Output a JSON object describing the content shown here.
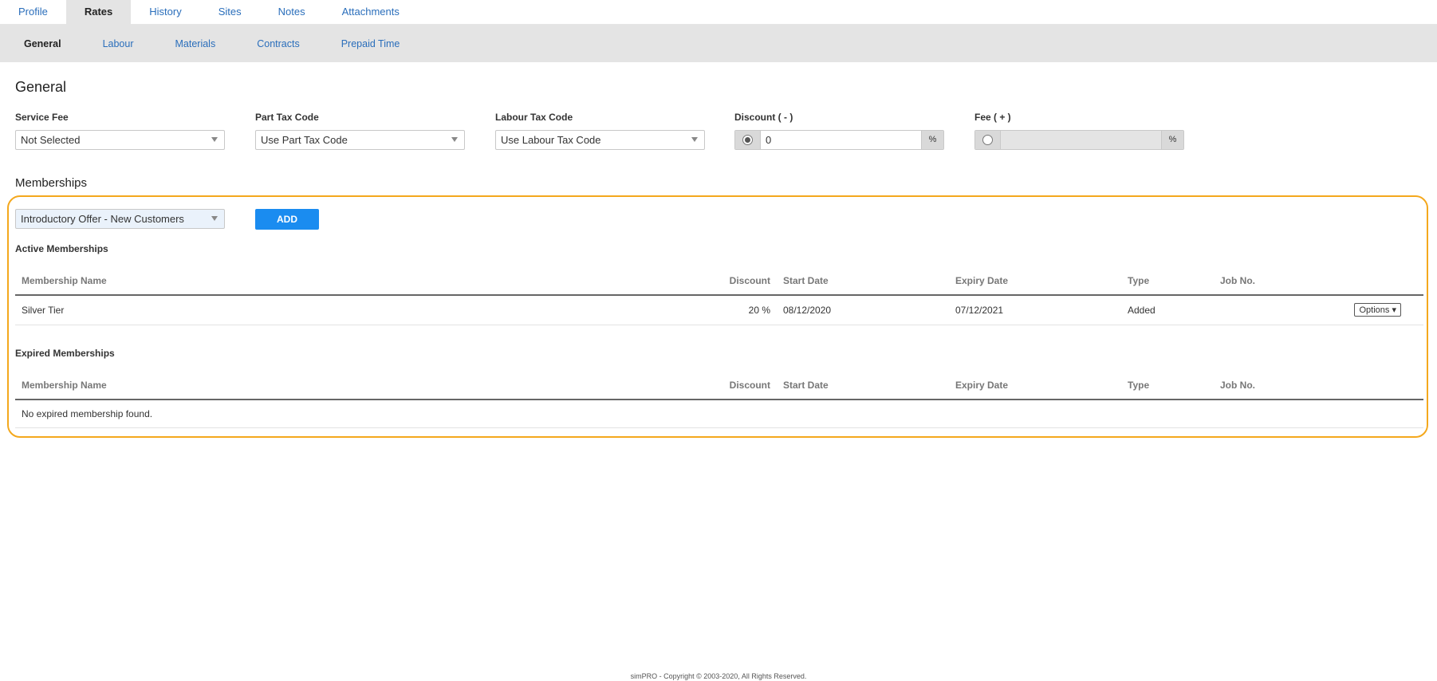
{
  "top_tabs": [
    {
      "label": "Profile"
    },
    {
      "label": "Rates"
    },
    {
      "label": "History"
    },
    {
      "label": "Sites"
    },
    {
      "label": "Notes"
    },
    {
      "label": "Attachments"
    }
  ],
  "sub_tabs": [
    {
      "label": "General"
    },
    {
      "label": "Labour"
    },
    {
      "label": "Materials"
    },
    {
      "label": "Contracts"
    },
    {
      "label": "Prepaid Time"
    }
  ],
  "general": {
    "title": "General",
    "service_fee": {
      "label": "Service Fee",
      "value": "Not Selected"
    },
    "part_tax": {
      "label": "Part Tax Code",
      "value": "Use Part Tax Code"
    },
    "labour_tax": {
      "label": "Labour Tax Code",
      "value": "Use Labour Tax Code"
    },
    "discount": {
      "label": "Discount ( - )",
      "value": "0",
      "suffix": "%"
    },
    "fee": {
      "label": "Fee ( + )",
      "value": "",
      "suffix": "%"
    }
  },
  "memberships": {
    "title": "Memberships",
    "selected": "Introductory Offer - New Customers",
    "add_label": "ADD",
    "active_title": "Active Memberships",
    "expired_title": "Expired Memberships",
    "columns": [
      "Membership Name",
      "Discount",
      "Start Date",
      "Expiry Date",
      "Type",
      "Job No."
    ],
    "active_rows": [
      {
        "name": "Silver Tier",
        "discount": "20 %",
        "start": "08/12/2020",
        "expiry": "07/12/2021",
        "type": "Added",
        "job": "",
        "options": "Options"
      }
    ],
    "expired_empty": "No expired membership found."
  },
  "footer": "simPRO - Copyright © 2003-2020, All Rights Reserved.",
  "colors": {
    "accent": "#1a8cf0",
    "highlight_border": "#f4a81d",
    "link": "#2a6ebb"
  }
}
